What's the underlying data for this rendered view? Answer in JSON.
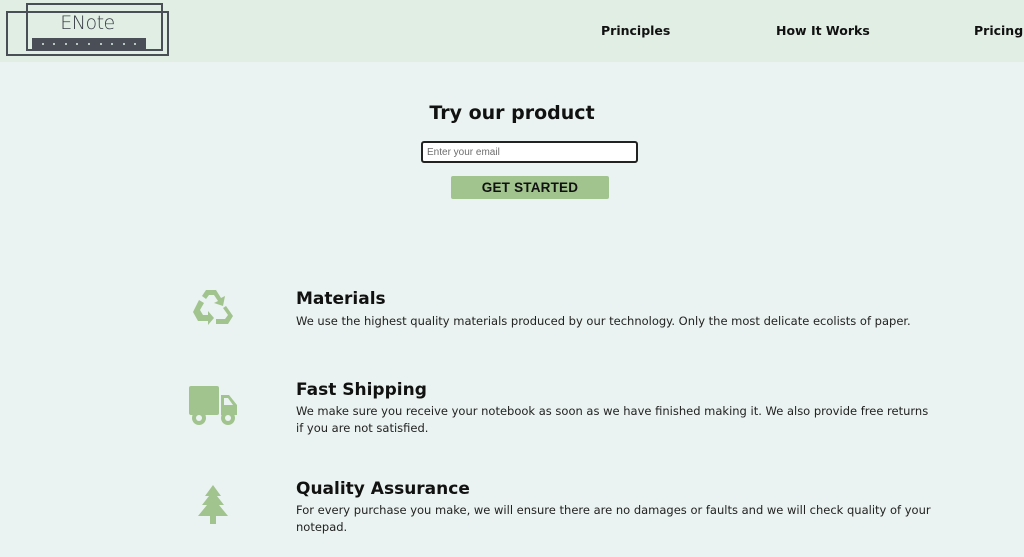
{
  "header": {
    "logo_text": "ENote",
    "nav": [
      {
        "label": "Principles"
      },
      {
        "label": "How It Works"
      },
      {
        "label": "Pricing"
      }
    ]
  },
  "hero": {
    "title": "Try our product",
    "email_placeholder": "Enter your email",
    "email_value": "",
    "cta_label": "GET STARTED"
  },
  "features": [
    {
      "icon": "recycle-icon",
      "title": "Materials",
      "description": "We use the highest quality materials produced by our technology. Only the most delicate ecolists of paper."
    },
    {
      "icon": "truck-icon",
      "title": "Fast Shipping",
      "description": "We make sure you receive your notebook as soon as we have finished making it. We also provide free returns if you are not satisfied."
    },
    {
      "icon": "tree-icon",
      "title": "Quality Assurance",
      "description": "For every purchase you make, we will ensure there are no damages or faults and we will check quality of your notepad."
    }
  ],
  "colors": {
    "header_bg": "#e0eee4",
    "page_bg": "#eaf3f1",
    "accent": "#a1c48f",
    "logo": "#4a4f57"
  }
}
